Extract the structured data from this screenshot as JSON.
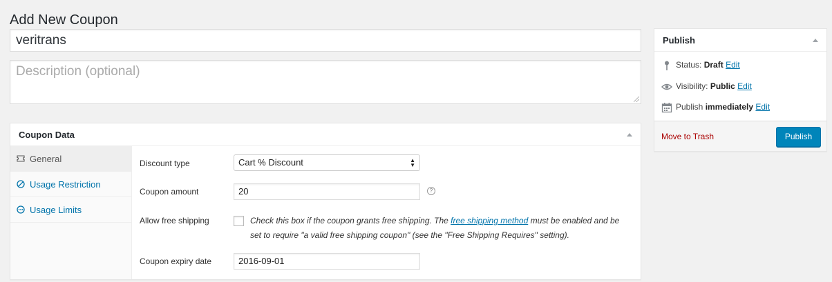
{
  "page": {
    "title": "Add New Coupon"
  },
  "coupon": {
    "code": "veritrans",
    "description_placeholder": "Description (optional)"
  },
  "coupon_data": {
    "title": "Coupon Data",
    "tabs": [
      {
        "label": "General",
        "icon": "ticket-icon",
        "active": true
      },
      {
        "label": "Usage Restriction",
        "icon": "restriction-icon",
        "active": false
      },
      {
        "label": "Usage Limits",
        "icon": "limits-icon",
        "active": false
      }
    ],
    "general": {
      "discount_type": {
        "label": "Discount type",
        "value": "Cart % Discount"
      },
      "coupon_amount": {
        "label": "Coupon amount",
        "value": "20",
        "help": "?"
      },
      "free_shipping": {
        "label": "Allow free shipping",
        "checked": false,
        "text_before": "Check this box if the coupon grants free shipping. The ",
        "link_text": "free shipping method",
        "text_after": " must be enabled and be set to require \"a valid free shipping coupon\" (see the \"Free Shipping Requires\" setting)."
      },
      "expiry_date": {
        "label": "Coupon expiry date",
        "value": "2016-09-01"
      }
    }
  },
  "publish": {
    "title": "Publish",
    "status_label": "Status:",
    "status_value": "Draft",
    "visibility_label": "Visibility:",
    "visibility_value": "Public",
    "schedule_label": "Publish",
    "schedule_value": "immediately",
    "edit_label": "Edit",
    "trash_label": "Move to Trash",
    "publish_button": "Publish"
  },
  "colors": {
    "accent": "#0073aa",
    "button": "#0085ba",
    "trash": "#a00000",
    "background": "#f1f1f1"
  }
}
